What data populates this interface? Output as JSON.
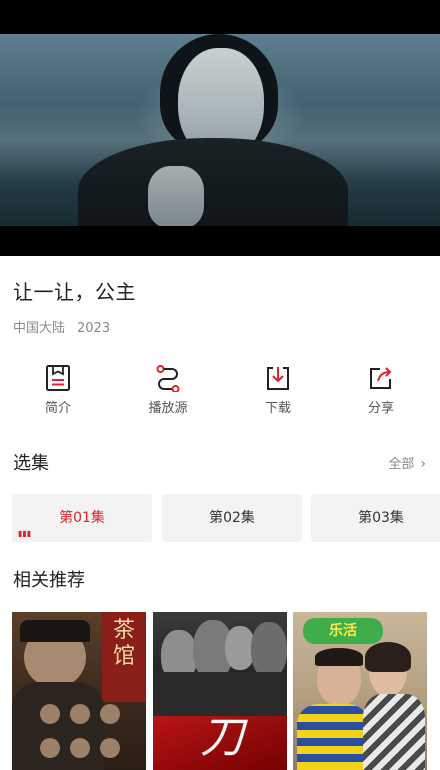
{
  "video": {
    "label": ""
  },
  "show": {
    "title": "让一让，公主",
    "region": "中国大陆",
    "year": "2023"
  },
  "actions": [
    {
      "label": "简介",
      "icon": "intro-icon"
    },
    {
      "label": "播放源",
      "icon": "source-icon"
    },
    {
      "label": "下载",
      "icon": "download-icon"
    },
    {
      "label": "分享",
      "icon": "share-icon"
    }
  ],
  "episodes_section": {
    "title": "选集",
    "all_label": "全部",
    "items": [
      {
        "label": "第01集",
        "active": true
      },
      {
        "label": "第02集",
        "active": false
      },
      {
        "label": "第03集",
        "active": false
      }
    ]
  },
  "recommend_section": {
    "title": "相关推荐",
    "posters": [
      {
        "name": "poster-1",
        "art_text": "茶馆"
      },
      {
        "name": "poster-2",
        "art_text": "刀"
      },
      {
        "name": "poster-3",
        "art_text": "乐活"
      }
    ]
  },
  "colors": {
    "accent": "#e0232e",
    "text_primary": "#222222",
    "text_secondary": "#888888",
    "chip_bg": "#f3f3f3"
  }
}
